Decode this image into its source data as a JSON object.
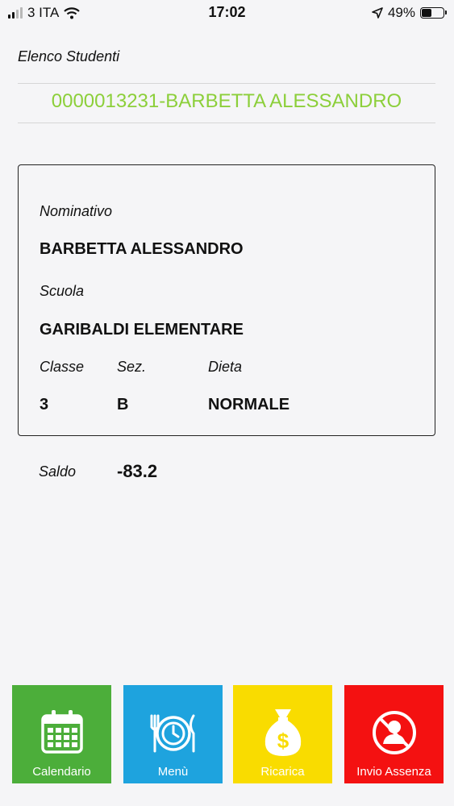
{
  "status_bar": {
    "carrier": "3 ITA",
    "time": "17:02",
    "battery": "49%",
    "battery_level": 0.49
  },
  "nav": {
    "title": "Elenco Studenti"
  },
  "student_select": {
    "value": "0000013231-BARBETTA ALESSANDRO"
  },
  "card": {
    "nominativo_label": "Nominativo",
    "nominativo_value": "BARBETTA ALESSANDRO",
    "scuola_label": "Scuola",
    "scuola_value": "GARIBALDI ELEMENTARE",
    "classe_label": "Classe",
    "classe_value": "3",
    "sez_label": "Sez.",
    "sez_value": "B",
    "dieta_label": "Dieta",
    "dieta_value": "NORMALE"
  },
  "saldo": {
    "label": "Saldo",
    "value": "-83.2"
  },
  "tiles": [
    {
      "label": "Calendario",
      "icon": "calendar-icon",
      "color": "#4cae3a"
    },
    {
      "label": "Menù",
      "icon": "plate-cutlery-icon",
      "color": "#1ea3de"
    },
    {
      "label": "Ricarica",
      "icon": "money-bag-icon",
      "color": "#f9dc00"
    },
    {
      "label": "Invio Assenza",
      "icon": "absence-icon",
      "color": "#f41111"
    }
  ]
}
